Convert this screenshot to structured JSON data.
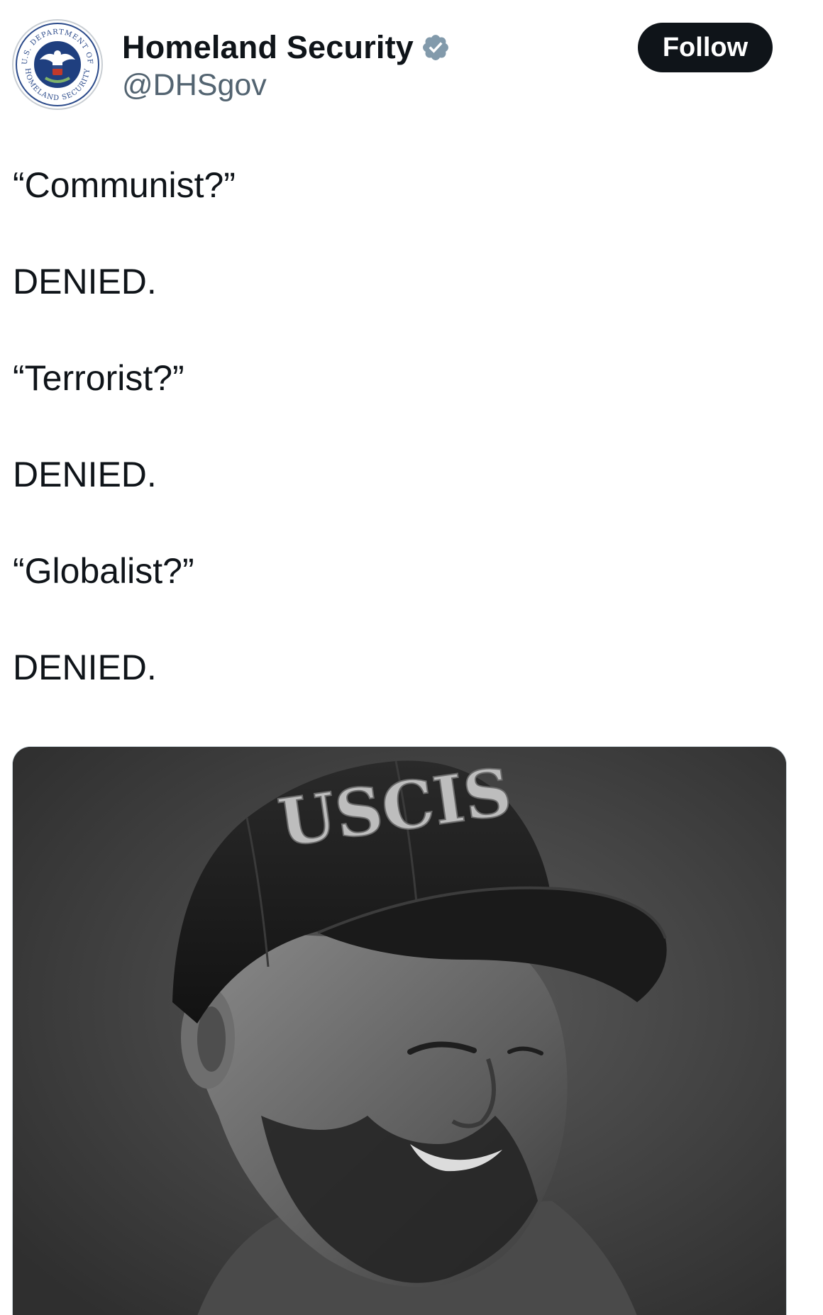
{
  "tweet": {
    "author": {
      "display_name": "Homeland Security",
      "handle": "@DHSgov",
      "verified": true,
      "avatar": {
        "icon": "dhs-seal",
        "seal_text_top": "U.S. DEPARTMENT OF",
        "seal_text_bottom": "HOMELAND SECURITY"
      }
    },
    "follow_label": "Follow",
    "text_lines": [
      "“Communist?”",
      "DENIED.",
      "“Terrorist?”",
      "DENIED.",
      "“Globalist?”",
      "DENIED."
    ],
    "media": {
      "kind": "photo",
      "cap_text": "USCIS",
      "palette": "grayscale"
    }
  },
  "colors": {
    "text": "#0f1419",
    "secondary_text": "#536471",
    "follow_button_bg": "#0f1419",
    "follow_button_text": "#ffffff",
    "verified_badge": "#829aab",
    "background": "#ffffff"
  }
}
